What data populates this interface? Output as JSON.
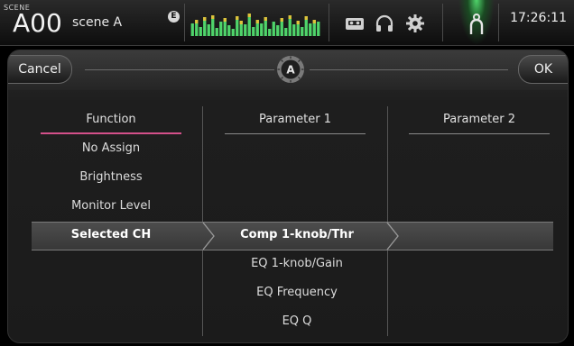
{
  "topbar": {
    "scene_label": "SCENE",
    "scene_number": "A00",
    "scene_name": "scene A",
    "edit_badge": "E",
    "time": "17:26:11",
    "icons": [
      "meter-icon",
      "recorder-icon",
      "headphones-icon",
      "settings-gear-icon",
      "user-icon"
    ]
  },
  "dialog": {
    "cancel_label": "Cancel",
    "ok_label": "OK",
    "header_icon": "user-defined-knob-a-icon",
    "header_icon_letter": "A"
  },
  "columns": {
    "function": {
      "title": "Function",
      "items": [
        "No Assign",
        "Brightness",
        "Monitor Level",
        "Selected CH"
      ],
      "selected": "Selected CH"
    },
    "parameter1": {
      "title": "Parameter 1",
      "items": [
        "Comp 1-knob/Thr",
        "EQ 1-knob/Gain",
        "EQ Frequency",
        "EQ Q"
      ],
      "selected": "Comp 1-knob/Thr"
    },
    "parameter2": {
      "title": "Parameter 2",
      "items": []
    }
  },
  "colors": {
    "accent_pink": "#d4508a",
    "meter_green": "#4fd46a",
    "meter_yellow": "#e0c23a"
  }
}
